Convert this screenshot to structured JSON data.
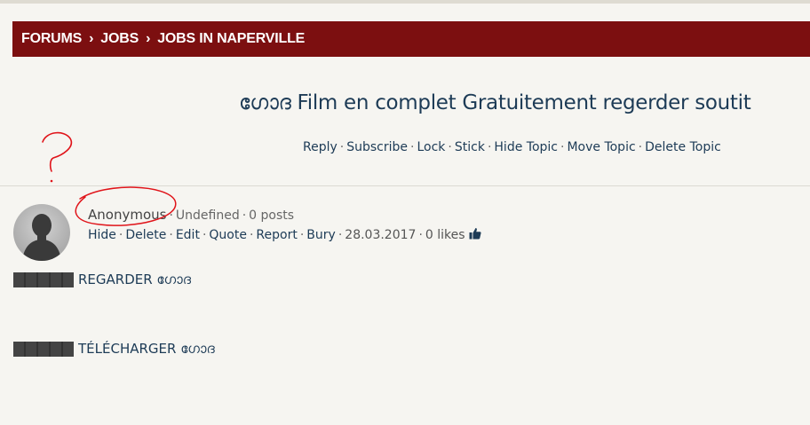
{
  "breadcrumb": {
    "items": [
      "FORUMS",
      "JOBS",
      "JOBS IN NAPERVILLE"
    ],
    "separator": "›"
  },
  "topic": {
    "title": "ഗോദ Film en complet Gratuitement regerder soutit",
    "actions": [
      "Reply",
      "Subscribe",
      "Lock",
      "Stick",
      "Hide Topic",
      "Move Topic",
      "Delete Topic"
    ]
  },
  "post": {
    "author": "Anonymous",
    "author_meta": [
      "Undefined",
      "0 posts"
    ],
    "actions": [
      "Hide",
      "Delete",
      "Edit",
      "Quote",
      "Report",
      "Bury"
    ],
    "date": "28.03.2017",
    "likes": "0 likes",
    "lines": [
      "REGARDER ഗോദ",
      "TÉLÉCHARGER ഗോദ"
    ]
  },
  "annotation": {
    "mark": "?",
    "color": "#e0141a"
  },
  "colors": {
    "header_bg": "#7c0f10",
    "page_bg": "#f6f5f1",
    "link": "#1d3b56"
  },
  "icons": {
    "avatar": "default-user-avatar",
    "like": "thumbs-up-icon"
  }
}
